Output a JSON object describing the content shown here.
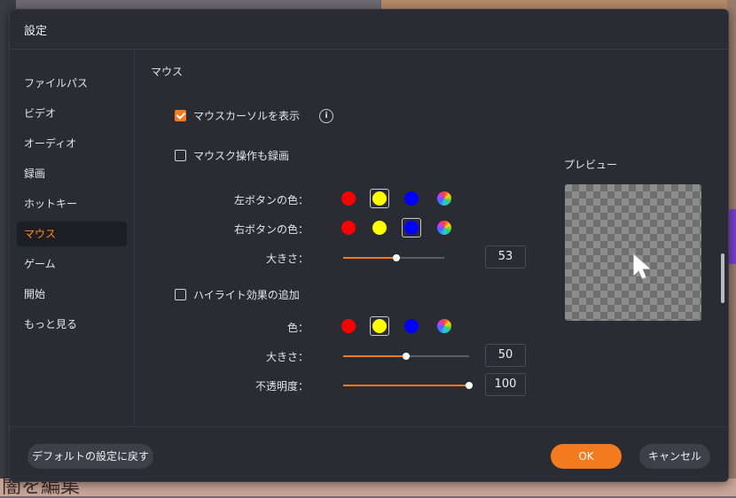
{
  "dialog": {
    "title": "設定",
    "sidebar": {
      "items": [
        {
          "label": "ファイルパス"
        },
        {
          "label": "ビデオ"
        },
        {
          "label": "オーディオ"
        },
        {
          "label": "録画"
        },
        {
          "label": "ホットキー"
        },
        {
          "label": "マウス",
          "active": true
        },
        {
          "label": "ゲーム"
        },
        {
          "label": "開始"
        },
        {
          "label": "もっと見る"
        }
      ]
    },
    "mouse": {
      "section_title": "マウス",
      "show_cursor": {
        "label": "マウスカーソルを表示",
        "checked": true
      },
      "record_clicks": {
        "label": "マウスク操作も録画",
        "checked": false,
        "left_color_label": "左ボタンの色：",
        "right_color_label": "右ボタンの色：",
        "size_label": "大きさ：",
        "size_value": "53",
        "size_fraction": 0.53
      },
      "highlight": {
        "label": "ハイライト効果の追加",
        "checked": false,
        "color_label": "色：",
        "size_label": "大きさ：",
        "size_value": "50",
        "size_fraction": 0.5,
        "opacity_label": "不透明度：",
        "opacity_value": "100",
        "opacity_fraction": 1.0
      },
      "colors": {
        "red": "#ff0000",
        "yellow": "#ffff00",
        "blue": "#0000ff",
        "accent": "#f47a20"
      },
      "left_selected": "yellow",
      "right_selected": "blue",
      "highlight_selected": "yellow"
    },
    "preview": {
      "label": "プレビュー"
    },
    "footer": {
      "default_label": "デフォルトの設定に戻す",
      "ok_label": "OK",
      "cancel_label": "キャンセル"
    }
  },
  "background": {
    "bottom_text": "闇を編集"
  }
}
